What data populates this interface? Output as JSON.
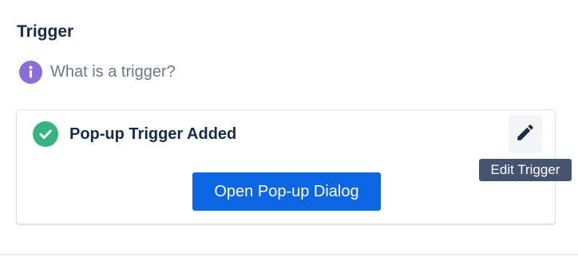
{
  "section": {
    "title": "Trigger"
  },
  "help": {
    "icon": "info-icon",
    "label": "What is a trigger?",
    "icon_color": "#8a6ed8"
  },
  "card": {
    "status_icon": "check-circle-icon",
    "status_icon_color": "#36b37e",
    "status_text": "Pop-up Trigger Added",
    "edit_icon": "pencil-icon",
    "primary_button_label": "Open Pop-up Dialog",
    "primary_button_color": "#0c66e4"
  },
  "tooltip": {
    "text": "Edit Trigger",
    "background": "#44546f"
  }
}
